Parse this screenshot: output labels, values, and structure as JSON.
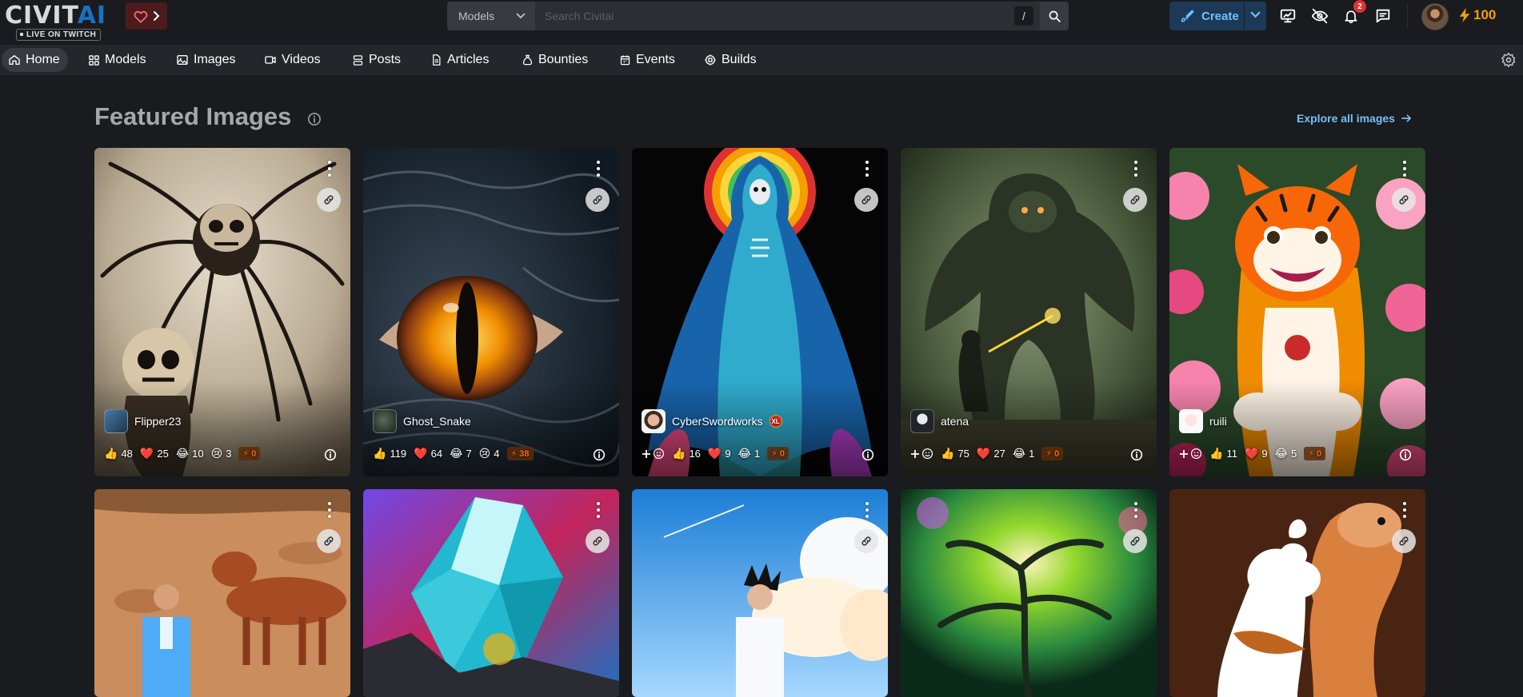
{
  "header": {
    "logo_main": "CIVIT",
    "logo_accent": "AI",
    "logo_badge": "LIVE ON TWITCH",
    "search": {
      "category": "Models",
      "placeholder": "Search Civitai",
      "shortcut": "/"
    },
    "create_label": "Create",
    "notification_count": "2",
    "buzz_amount": "100"
  },
  "nav": {
    "items": [
      {
        "label": "Home",
        "icon": "home-icon",
        "active": true
      },
      {
        "label": "Models",
        "icon": "grid-icon"
      },
      {
        "label": "Images",
        "icon": "photo-icon"
      },
      {
        "label": "Videos",
        "icon": "video-icon"
      },
      {
        "label": "Posts",
        "icon": "posts-icon"
      },
      {
        "label": "Articles",
        "icon": "file-icon"
      },
      {
        "label": "Bounties",
        "icon": "moneybag-icon"
      },
      {
        "label": "Events",
        "icon": "calendar-icon"
      },
      {
        "label": "Builds",
        "icon": "cpu-icon"
      }
    ]
  },
  "section": {
    "title": "Featured Images",
    "explore_label": "Explore all images"
  },
  "cards": [
    {
      "user": "Flipper23",
      "likes": "48",
      "hearts": "25",
      "laughs": "10",
      "cries": "3",
      "buzz": "0",
      "reaction_add": false
    },
    {
      "user": "Ghost_Snake",
      "likes": "119",
      "hearts": "64",
      "laughs": "7",
      "cries": "4",
      "buzz": "38",
      "reaction_add": false
    },
    {
      "user": "CyberSwordworks",
      "likes": "16",
      "hearts": "9",
      "laughs": "1",
      "buzz": "0",
      "reaction_add": true,
      "badge": "XL"
    },
    {
      "user": "atena",
      "likes": "75",
      "hearts": "27",
      "laughs": "1",
      "buzz": "0",
      "reaction_add": true
    },
    {
      "user": "ruili",
      "likes": "11",
      "hearts": "9",
      "laughs": "5",
      "buzz": "0",
      "reaction_add": true
    }
  ],
  "colors": {
    "accent": "#74c0fc",
    "buzz": "#f59f00",
    "danger": "#e03131",
    "background": "#1a1b1e"
  }
}
